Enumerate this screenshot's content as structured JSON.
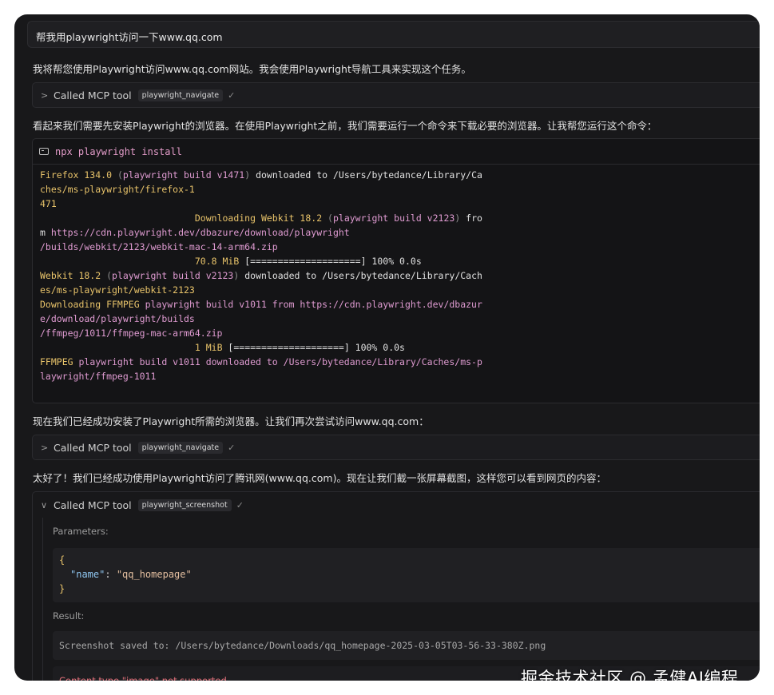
{
  "user_message": "帮我用playwright访问一下www.qq.com",
  "messages": [
    "我将帮您使用Playwright访问www.qq.com网站。我会使用Playwright导航工具来实现这个任务。",
    "看起来我们需要先安装Playwright的浏览器。在使用Playwright之前，我们需要运行一个命令来下载必要的浏览器。让我帮您运行这个命令：",
    "现在我们已经成功安装了Playwright所需的浏览器。让我们再次尝试访问www.qq.com：",
    "太好了！我们已经成功使用Playwright访问了腾讯网(www.qq.com)。现在让我们截一张屏幕截图，这样您可以看到网页的内容："
  ],
  "tool_calls": [
    {
      "label": "Called MCP tool",
      "name": "playwright_navigate",
      "chevron": ">",
      "check": "✓"
    },
    {
      "label": "Called MCP tool",
      "name": "playwright_navigate",
      "chevron": ">",
      "check": "✓"
    },
    {
      "label": "Called MCP tool",
      "name": "playwright_screenshot",
      "chevron": "∨",
      "check": "✓"
    }
  ],
  "terminal": {
    "command": "npx playwright install",
    "lines": [
      [
        [
          "y",
          "Firefox 134.0 "
        ],
        [
          "g",
          "("
        ],
        [
          "p",
          "playwright build v1471"
        ],
        [
          "g",
          ")"
        ],
        [
          "w",
          " downloaded to /Users/bytedance/Library/Ca"
        ]
      ],
      [
        [
          "y",
          "ches/ms-playwright/firefox-1"
        ]
      ],
      [
        [
          "y",
          "471"
        ]
      ],
      [
        [
          "w",
          "                            "
        ],
        [
          "y",
          "Downloading Webkit 18.2 "
        ],
        [
          "g",
          "("
        ],
        [
          "p",
          "playwright build v2123"
        ],
        [
          "g",
          ")"
        ],
        [
          "w",
          " fro"
        ]
      ],
      [
        [
          "w",
          "m "
        ],
        [
          "p",
          "https://cdn.playwright.dev/dbazure/download/playwright"
        ]
      ],
      [
        [
          "p",
          "/builds/webkit/2123/webkit-mac-14-arm64.zip"
        ]
      ],
      [
        [
          "w",
          "                            "
        ],
        [
          "y",
          "70.8 MiB "
        ],
        [
          "w",
          "[====================] 100% 0.0s"
        ]
      ],
      [
        [
          "y",
          "Webkit 18.2 "
        ],
        [
          "g",
          "("
        ],
        [
          "p",
          "playwright build v2123"
        ],
        [
          "g",
          ")"
        ],
        [
          "w",
          " downloaded to /Users/bytedance/Library/Cach"
        ]
      ],
      [
        [
          "y",
          "es/ms-playwright/webkit-2123"
        ]
      ],
      [
        [
          "y",
          "Downloading FFMPEG "
        ],
        [
          "p",
          "playwright build v1011 from https://cdn.playwright.dev/dbazur"
        ]
      ],
      [
        [
          "p",
          "e/download/playwright/builds"
        ]
      ],
      [
        [
          "p",
          "/ffmpeg/1011/ffmpeg-mac-arm64.zip"
        ]
      ],
      [
        [
          "w",
          "                            "
        ],
        [
          "y",
          "1 MiB "
        ],
        [
          "w",
          "[====================] 100% 0.0s"
        ]
      ],
      [
        [
          "y",
          "FFMPEG "
        ],
        [
          "p",
          "playwright build v1011 downloaded to /Users/bytedance/Library/Caches/ms-p"
        ]
      ],
      [
        [
          "p",
          "laywright/ffmpeg-1011"
        ]
      ]
    ]
  },
  "screenshot_call": {
    "parameters_label": "Parameters:",
    "param_open": "{",
    "param_key": "\"name\"",
    "param_colon": ": ",
    "param_value": "\"qq_homepage\"",
    "param_close": "}",
    "result_label": "Result:",
    "result_text": "Screenshot saved to: /Users/bytedance/Downloads/qq_homepage-2025-03-05T03-56-33-380Z.png",
    "error_text": "Content type \"image\" not supported"
  },
  "watermark": "掘金技术社区 @ 孟健AI编程"
}
